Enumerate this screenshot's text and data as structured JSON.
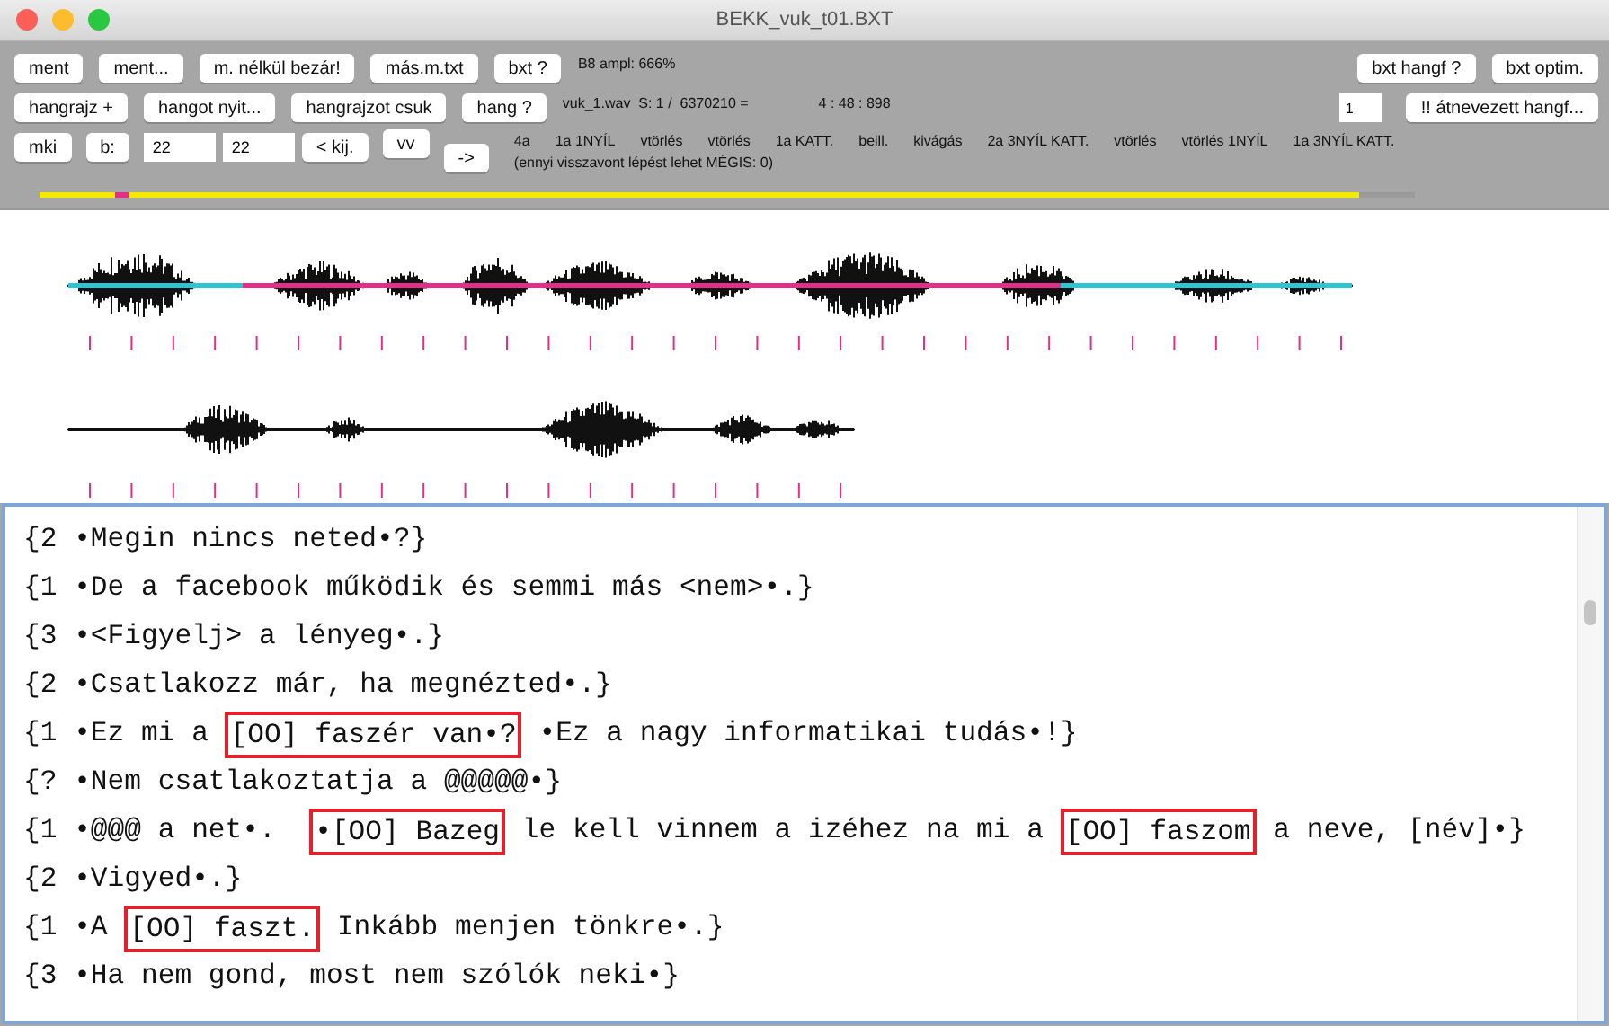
{
  "window": {
    "title": "BEKK_vuk_t01.BXT"
  },
  "toolbar": {
    "row1": {
      "buttons": [
        "ment",
        "ment...",
        "m. nélkül bezár!",
        "más.m.txt",
        "bxt ?"
      ],
      "info": "B8 ampl: 666%",
      "right_buttons": [
        "bxt hangf ?",
        "bxt optim."
      ]
    },
    "row2": {
      "buttons": [
        "hangrajz +",
        "hangot nyit...",
        "hangrajzot csuk",
        "hang ?"
      ],
      "info": "vuk_1.wav  S: 1 /  6370210 =",
      "time": "4 : 48 : 898",
      "field": "1",
      "right_button": "!! átnevezett hangf..."
    },
    "row3": {
      "buttons": [
        "mki",
        "b:"
      ],
      "fields": [
        "22",
        "22"
      ],
      "buttons_after": [
        "< kij.",
        "vv",
        "->"
      ],
      "actions": [
        "4a",
        "1a 1NYÍL",
        "vtörlés",
        "vtörlés",
        "1a KATT.",
        "beill.",
        "kivágás",
        "2a 3NYÍL KATT.",
        "vtörlés",
        "vtörlés 1NYÍL",
        "1a 3NYÍL KATT."
      ],
      "note": "(ennyi visszavont lépést lehet MÉGIS: 0)"
    }
  },
  "scroller": {
    "level": 0.96
  },
  "playhead": {
    "level": 0.055
  },
  "transcript": [
    {
      "segments": [
        {
          "text": "{2 •Megin nincs neted•?}",
          "boxed": false
        }
      ]
    },
    {
      "segments": [
        {
          "text": "{1 •De a facebook működik és semmi más <nem>•.}",
          "boxed": false
        }
      ]
    },
    {
      "segments": [
        {
          "text": "{3 •<Figyelj> a lényeg•.}",
          "boxed": false
        }
      ]
    },
    {
      "segments": [
        {
          "text": "{2 •Csatlakozz már, ha megnézted•.}",
          "boxed": false
        }
      ]
    },
    {
      "segments": [
        {
          "text": "{1 •Ez mi a ",
          "boxed": false
        },
        {
          "text": "[OO] faszér van•?",
          "boxed": true
        },
        {
          "text": " •Ez a nagy informatikai tudás•!}",
          "boxed": false
        }
      ]
    },
    {
      "segments": [
        {
          "text": "{? •Nem csatlakoztatja a @@@@@•}",
          "boxed": false
        }
      ]
    },
    {
      "segments": [
        {
          "text": "{1 •@@@ a net•.  ",
          "boxed": false
        },
        {
          "text": "•[OO] Bazeg",
          "boxed": true
        },
        {
          "text": " le kell vinnem a izéhez na mi a ",
          "boxed": false
        },
        {
          "text": "[OO] faszom",
          "boxed": true
        },
        {
          "text": " a neve, [név]•}",
          "boxed": false
        }
      ]
    },
    {
      "segments": [
        {
          "text": "{2 •Vigyed•.}",
          "boxed": false
        }
      ]
    },
    {
      "segments": [
        {
          "text": "{1 •A ",
          "boxed": false
        },
        {
          "text": "[OO] faszt.",
          "boxed": true
        },
        {
          "text": " Inkább menjen tönkre•.}",
          "boxed": false
        }
      ]
    },
    {
      "segments": [
        {
          "text": "{3 •Ha nem gond, most nem szólók neki•}",
          "boxed": false
        }
      ]
    }
  ]
}
